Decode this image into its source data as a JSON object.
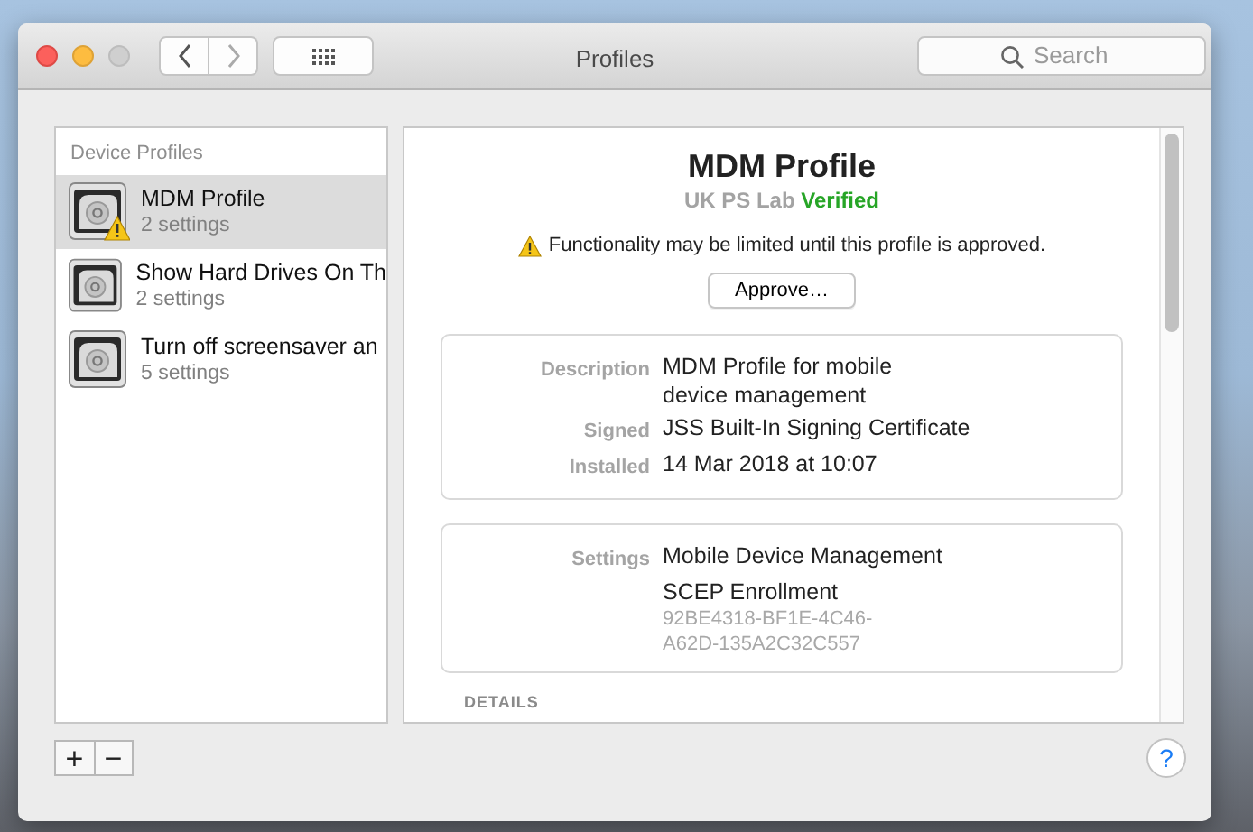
{
  "window": {
    "title": "Profiles"
  },
  "toolbar": {
    "search": {
      "placeholder": "Search"
    }
  },
  "sidebar": {
    "heading": "Device Profiles",
    "items": [
      {
        "name": "MDM Profile",
        "subtitle": "2 settings",
        "warning": true,
        "selected": true
      },
      {
        "name": "Show Hard Drives On Th",
        "subtitle": "2 settings",
        "warning": false,
        "selected": false
      },
      {
        "name": "Turn off screensaver an",
        "subtitle": "5 settings",
        "warning": false,
        "selected": false
      }
    ]
  },
  "detail": {
    "title": "MDM Profile",
    "organization": "UK PS Lab",
    "status": "Verified",
    "warning": "Functionality may be limited until this profile is approved.",
    "approve_button": "Approve…",
    "info_rows": [
      {
        "label": "Description",
        "value": "MDM Profile for mobile device management"
      },
      {
        "label": "Signed",
        "value": "JSS Built-In Signing Certificate"
      },
      {
        "label": "Installed",
        "value": "14 Mar 2018 at 10:07"
      }
    ],
    "settings": {
      "label": "Settings",
      "items": [
        {
          "name": "Mobile Device Management"
        },
        {
          "name": "SCEP Enrollment",
          "detail": "92BE4318-BF1E-4C46-A62D-135A2C32C557"
        }
      ]
    },
    "section_heading": "DETAILS"
  },
  "bottom_bar": {
    "add": "+",
    "remove": "−",
    "help": "?"
  }
}
